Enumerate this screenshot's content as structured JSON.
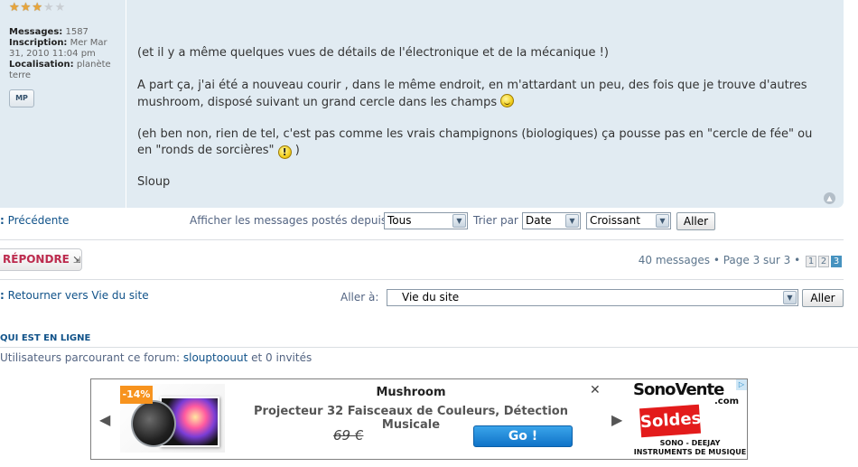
{
  "profile": {
    "rank_stars": 3,
    "rank_stars_total": 5,
    "messages_label": "Messages:",
    "messages_value": "1587",
    "inscription_label": "Inscription:",
    "inscription_value": "Mer Mar 31, 2010 11:04 pm",
    "localisation_label": "Localisation:",
    "localisation_value": "planète terre",
    "pm_button": "MP"
  },
  "post": {
    "p1": "(et il y a même quelques vues de détails de l'électronique et de la mécanique !)",
    "p2": "A part ça, j'ai été a nouveau courir , dans le même endroit, en m'attardant un peu, des fois que je trouve d'autres mushroom, disposé suivant un grand cercle dans les champs",
    "p3a": "(eh ben non, rien de tel, c'est pas comme les vrais champignons (biologiques) ça pousse pas en \"cercle de fée\" ou en \"ronds de sorcières\"",
    "p3b": ")",
    "signature": "Sloup",
    "smiley1": "smile-icon",
    "smiley2": "exclamation-icon"
  },
  "sortbar": {
    "prev_link": "Précédente",
    "display_label": "Afficher les messages postés depuis:",
    "display_value": "Tous",
    "sort_label": "Trier par",
    "sort_value": "Date",
    "order_value": "Croissant",
    "go_button": "Aller"
  },
  "actions": {
    "reply_button": "RÉPONDRE",
    "pagination_text": "40 messages • Page 3 sur 3 •",
    "pages": [
      "1",
      "2",
      "3"
    ],
    "current_page": "3"
  },
  "jump": {
    "return_link": "Retourner vers Vie du site",
    "jump_label": "Aller à:",
    "jump_value": "Vie du site",
    "jump_button": "Aller"
  },
  "online": {
    "title": "QUI EST EN LIGNE",
    "text_prefix": "Utilisateurs parcourant ce forum:",
    "user": "slouptoouut",
    "text_suffix": "et 0 invités"
  },
  "ad": {
    "discount": "-14%",
    "title": "Mushroom",
    "description": "Projecteur 32 Faisceaux de Couleurs, Détection Musicale",
    "price": "69 €",
    "cta": "Go !",
    "brand_name": "SonoVente",
    "brand_tld": ".com",
    "brand_banner": "Soldes",
    "brand_line1": "SONO - DEEJAY",
    "brand_line2": "INSTRUMENTS DE MUSIQUE"
  }
}
